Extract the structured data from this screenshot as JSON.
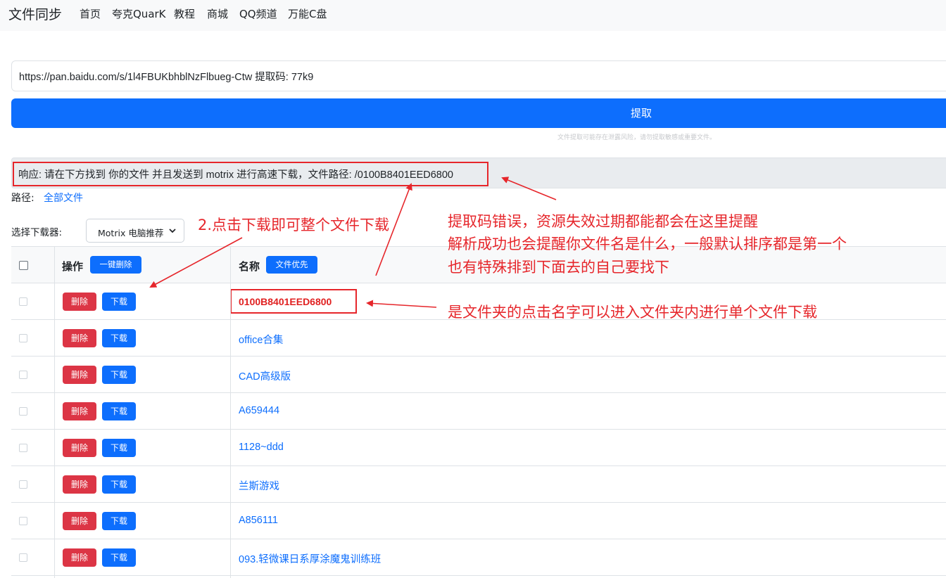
{
  "navbar": {
    "brand": "文件同步",
    "links": [
      "首页",
      "夸克QuarK",
      "教程",
      "商城",
      "QQ频道",
      "万能C盘"
    ]
  },
  "form": {
    "url_value": "https://pan.baidu.com/s/1l4FBUKbhblNzFlbueg-Ctw 提取码: 77k9",
    "extract_label": "提取",
    "hint": "文件提取可能存在泄露风险，请勿提取敏感或重要文件。"
  },
  "response": {
    "text": "响应: 请在下方找到 你的文件 并且发送到 motrix 进行高速下载，文件路径: /0100B8401EED6800"
  },
  "path": {
    "label": "路径:",
    "link": "全部文件"
  },
  "downloader": {
    "label": "选择下载器:",
    "selected": "Motrix 电脑推荐"
  },
  "table": {
    "head_op": "操作",
    "head_bulk_delete": "一键删除",
    "head_name": "名称",
    "head_folder_first": "文件优先",
    "delete_label": "删除",
    "download_label": "下载",
    "rows": [
      {
        "name": "0100B8401EED6800"
      },
      {
        "name": "office合集"
      },
      {
        "name": "CAD高级版"
      },
      {
        "name": "A659444"
      },
      {
        "name": "1128~ddd"
      },
      {
        "name": "兰斯游戏"
      },
      {
        "name": "A856111"
      },
      {
        "name": "093.轻微课日系厚涂魔鬼训练班"
      }
    ]
  },
  "annotations": {
    "download_tip": "2.点击下载即可整个文件下载",
    "response_tip_1": "提取码错误，资源失效过期都能都会在这里提醒",
    "response_tip_2": "解析成功也会提醒你文件名是什么，一般默认排序都是第一个",
    "response_tip_3": "也有特殊排到下面去的自己要找下",
    "folder_tip": "是文件夹的点击名字可以进入文件夹内进行单个文件下载"
  },
  "colors": {
    "primary": "#0d6efd",
    "danger": "#dc3545",
    "annotation": "#e6262b"
  }
}
